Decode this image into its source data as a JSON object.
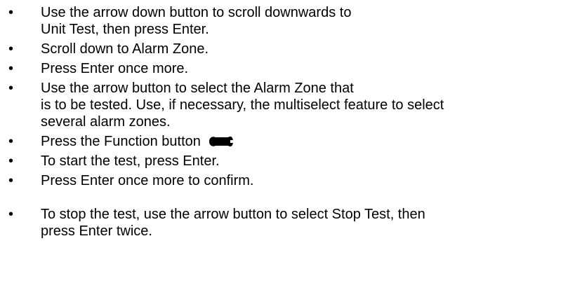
{
  "steps": [
    {
      "lines": [
        "Use the arrow down button to scroll downwards to",
        "Unit Test, then press Enter."
      ]
    },
    {
      "lines": [
        "Scroll down to Alarm Zone."
      ]
    },
    {
      "lines": [
        "Press Enter once more."
      ]
    },
    {
      "lines": [
        "Use the arrow button to select  the Alarm Zone that",
        "is to be tested. Use, if necessary, the multiselect feature to select",
        "several alarm zones."
      ]
    },
    {
      "lines": [
        "Press the Function button"
      ],
      "icon": "wrench-icon"
    },
    {
      "lines": [
        "To start the test, press Enter."
      ]
    },
    {
      "lines": [
        "Press Enter once more to confirm."
      ]
    },
    {
      "lines": [
        "To stop the test, use the arrow button to select Stop Test, then",
        "press Enter twice."
      ]
    }
  ]
}
